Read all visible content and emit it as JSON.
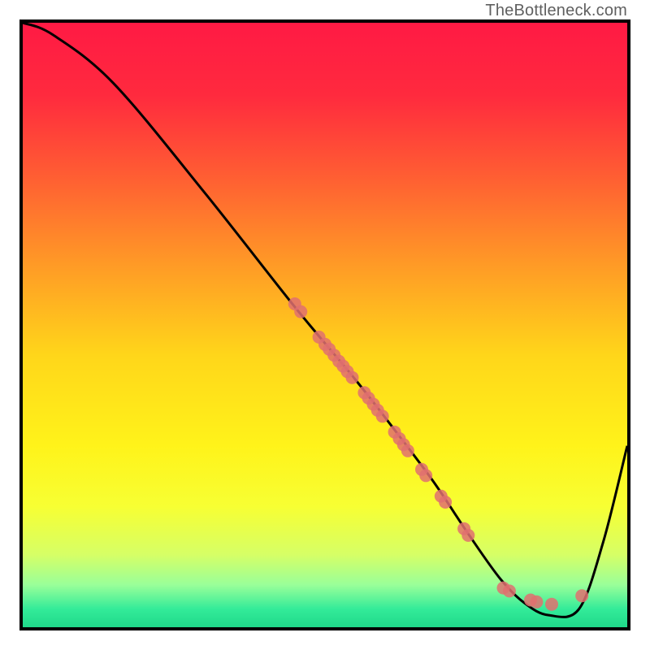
{
  "watermark": "TheBottleneck.com",
  "gradient_stops": [
    {
      "offset": 0.0,
      "color": "#ff1a44"
    },
    {
      "offset": 0.12,
      "color": "#ff2a3e"
    },
    {
      "offset": 0.25,
      "color": "#ff5c33"
    },
    {
      "offset": 0.4,
      "color": "#ff9a26"
    },
    {
      "offset": 0.55,
      "color": "#ffd61a"
    },
    {
      "offset": 0.7,
      "color": "#fff31a"
    },
    {
      "offset": 0.8,
      "color": "#f7ff33"
    },
    {
      "offset": 0.88,
      "color": "#d6ff66"
    },
    {
      "offset": 0.93,
      "color": "#99ff99"
    },
    {
      "offset": 0.97,
      "color": "#33eb99"
    },
    {
      "offset": 1.0,
      "color": "#1fd98a"
    }
  ],
  "chart_data": {
    "type": "line",
    "title": "",
    "xlabel": "",
    "ylabel": "",
    "xlim": [
      0,
      100
    ],
    "ylim": [
      0,
      100
    ],
    "series": [
      {
        "name": "bottleneck-curve",
        "x": [
          0,
          5,
          15,
          30,
          45,
          55,
          62,
          68,
          74,
          79,
          83,
          87,
          92,
          96,
          100
        ],
        "y": [
          100,
          98,
          90,
          72,
          53,
          41,
          32,
          24,
          15,
          8,
          4,
          2,
          3,
          14,
          30
        ]
      }
    ],
    "marker_clusters": [
      {
        "label": "cluster-a",
        "points": [
          {
            "x": 45.0,
            "y": 53.5
          },
          {
            "x": 46.0,
            "y": 52.2
          }
        ]
      },
      {
        "label": "cluster-b",
        "points": [
          {
            "x": 49.0,
            "y": 48.0
          },
          {
            "x": 50.0,
            "y": 46.8
          },
          {
            "x": 50.7,
            "y": 46.0
          },
          {
            "x": 51.5,
            "y": 45.0
          },
          {
            "x": 52.3,
            "y": 44.0
          },
          {
            "x": 53.0,
            "y": 43.2
          },
          {
            "x": 53.7,
            "y": 42.3
          },
          {
            "x": 54.5,
            "y": 41.3
          }
        ]
      },
      {
        "label": "cluster-c",
        "points": [
          {
            "x": 56.5,
            "y": 38.8
          },
          {
            "x": 57.2,
            "y": 37.9
          },
          {
            "x": 58.0,
            "y": 36.9
          },
          {
            "x": 58.7,
            "y": 35.9
          },
          {
            "x": 59.5,
            "y": 34.9
          }
        ]
      },
      {
        "label": "cluster-d",
        "points": [
          {
            "x": 61.5,
            "y": 32.3
          },
          {
            "x": 62.3,
            "y": 31.2
          },
          {
            "x": 63.0,
            "y": 30.2
          },
          {
            "x": 63.7,
            "y": 29.2
          }
        ]
      },
      {
        "label": "cluster-e",
        "points": [
          {
            "x": 66.0,
            "y": 26.1
          },
          {
            "x": 66.7,
            "y": 25.1
          }
        ]
      },
      {
        "label": "cluster-f",
        "points": [
          {
            "x": 69.2,
            "y": 21.7
          },
          {
            "x": 69.9,
            "y": 20.7
          }
        ]
      },
      {
        "label": "cluster-g",
        "points": [
          {
            "x": 73.0,
            "y": 16.3
          },
          {
            "x": 73.7,
            "y": 15.2
          }
        ]
      },
      {
        "label": "valley-points",
        "points": [
          {
            "x": 79.5,
            "y": 6.5
          },
          {
            "x": 80.5,
            "y": 6.0
          },
          {
            "x": 84.0,
            "y": 4.5
          },
          {
            "x": 85.0,
            "y": 4.2
          },
          {
            "x": 87.5,
            "y": 3.8
          },
          {
            "x": 92.5,
            "y": 5.2
          }
        ]
      }
    ],
    "marker_color": "#e07070",
    "marker_radius": 8
  }
}
